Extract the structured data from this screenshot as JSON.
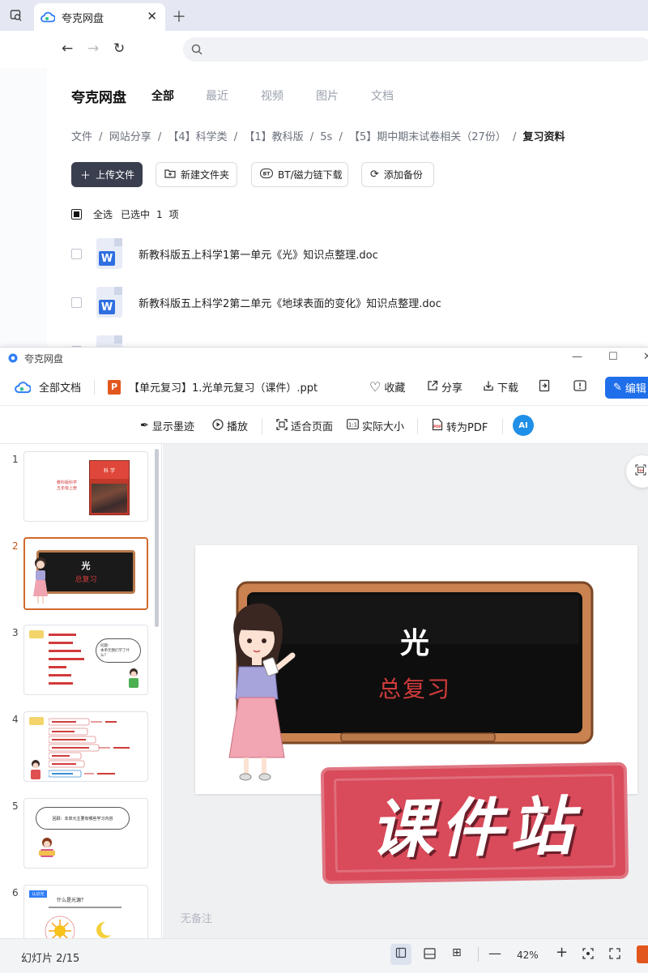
{
  "browser": {
    "tab_title": "夸克网盘",
    "address": ""
  },
  "quark": {
    "brand": "夸克网盘",
    "tabs": [
      {
        "label": "全部",
        "active": true
      },
      {
        "label": "最近",
        "active": false
      },
      {
        "label": "视频",
        "active": false
      },
      {
        "label": "图片",
        "active": false
      },
      {
        "label": "文档",
        "active": false
      }
    ],
    "breadcrumb": [
      "文件",
      "/",
      "网站分享",
      "/",
      "【4】科学类",
      "/",
      "【1】教科版",
      "/",
      "5s",
      "/",
      "【5】期中期末试卷相关（27份）",
      "/",
      "复习资料"
    ],
    "actions": {
      "upload": "上传文件",
      "new_folder": "新建文件夹",
      "bt": "BT/磁力链下载",
      "backup": "添加备份"
    },
    "selection": {
      "select_all": "全选",
      "selected_prefix": "已选中",
      "count": "1",
      "unit": "项"
    },
    "files": [
      {
        "name": "新教科版五上科学1第一单元《光》知识点整理.doc"
      },
      {
        "name": "新教科版五上科学2第二单元《地球表面的变化》知识点整理.doc"
      }
    ]
  },
  "viewer": {
    "window_title": "夸克网盘",
    "all_docs": "全部文档",
    "file_title": "【单元复习】1.光单元复习（课件）.ppt",
    "top_actions": {
      "collect": "收藏",
      "share": "分享",
      "download": "下载",
      "edit": "编辑"
    },
    "toolbar": {
      "ink": "显示墨迹",
      "play": "播放",
      "fit": "适合页面",
      "actual": "实际大小",
      "to_pdf": "转为PDF",
      "ai": "AI"
    },
    "thumbnails": [
      {
        "num": "1",
        "caption_line1": "教科版科学",
        "caption_line2": "五年级上册",
        "book": "科 学"
      },
      {
        "num": "2",
        "title": "光",
        "subtitle": "总复习"
      },
      {
        "num": "3",
        "bubble_line1": "问题：",
        "bubble_line2": "本单元我们学了什么？"
      },
      {
        "num": "4",
        "label": "知识链接"
      },
      {
        "num": "5",
        "bubble": "回顾：本单元主要有哪些学习内容"
      },
      {
        "num": "6",
        "heading": "什么是光源？",
        "label": "认识光"
      }
    ],
    "slide": {
      "title": "光",
      "subtitle": "总复习"
    },
    "notes": "无备注",
    "watermark": "课件站",
    "status": {
      "slide_counter": "幻灯片 2/15",
      "zoom": "42%"
    }
  },
  "colors": {
    "accent_blue": "#1f6feb",
    "selected_orange": "#d06a2c",
    "chalkboard": "#141414",
    "frame_brown": "#b9794a",
    "subtitle_red": "#d23b3b",
    "watermark_red": "#d94a5a"
  }
}
